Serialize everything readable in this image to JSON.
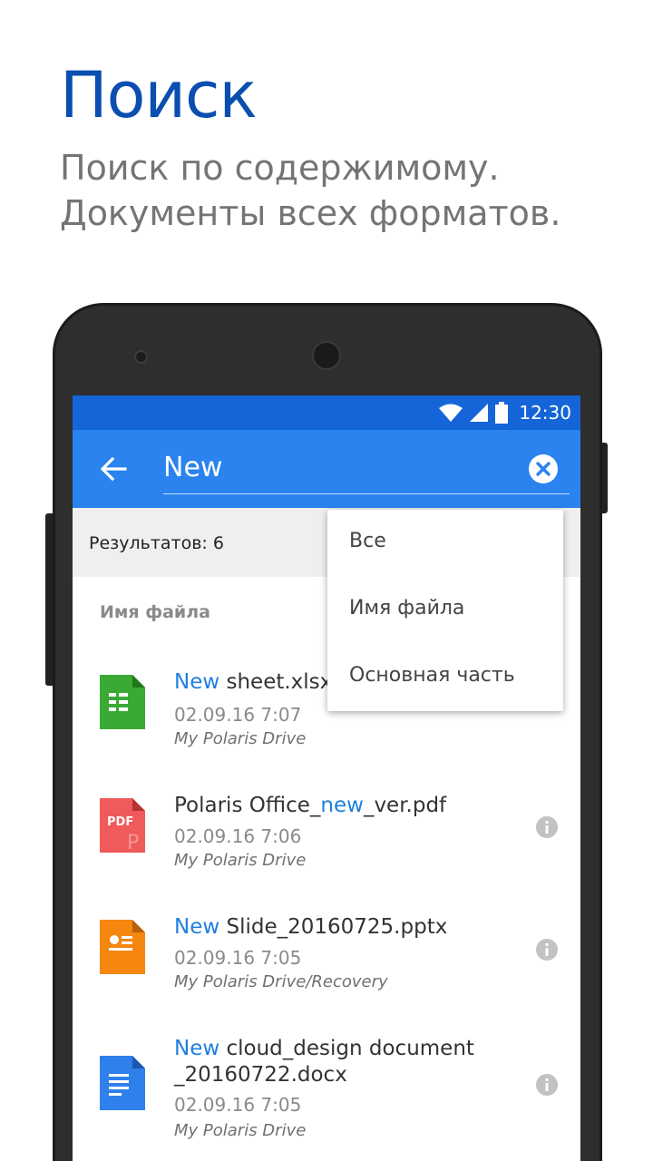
{
  "promo": {
    "title": "Поиск",
    "subtitle_line1": "Поиск по содержимому.",
    "subtitle_line2": "Документы всех форматов."
  },
  "status_bar": {
    "time": "12:30"
  },
  "search": {
    "value": "New"
  },
  "results": {
    "count_label": "Результатов: 6"
  },
  "section": {
    "header": "Имя файла"
  },
  "dropdown": {
    "options": [
      "Все",
      "Имя файла",
      "Основная часть"
    ]
  },
  "files": [
    {
      "name_hl": "New",
      "name_rest": " sheet.xlsx",
      "date": "02.09.16 7:07",
      "path": "My Polaris Drive",
      "type": "xlsx-icon"
    },
    {
      "name_pre": "Polaris Office_",
      "name_hl": "new",
      "name_post": "_ver.pdf",
      "date": "02.09.16 7:06",
      "path": "My Polaris Drive",
      "type": "pdf-icon",
      "badge": "PDF"
    },
    {
      "name_hl": "New",
      "name_rest": " Slide_20160725.pptx",
      "date": "02.09.16 7:05",
      "path": "My Polaris Drive/Recovery",
      "type": "pptx-icon"
    },
    {
      "name_hl": "New",
      "name_rest": " cloud_design document",
      "name_line2": "_20160722.docx",
      "date": "02.09.16 7:05",
      "path": "My Polaris Drive",
      "type": "docx-icon"
    }
  ],
  "colors": {
    "promo_title": "#0a4fb0",
    "status_bar": "#1565d8",
    "app_bar": "#2a83ee",
    "highlight": "#1e7fe0",
    "xlsx": "#3aaa35",
    "pdf": "#f05a5a",
    "pptx": "#f5860f",
    "docx": "#2f80ed"
  }
}
